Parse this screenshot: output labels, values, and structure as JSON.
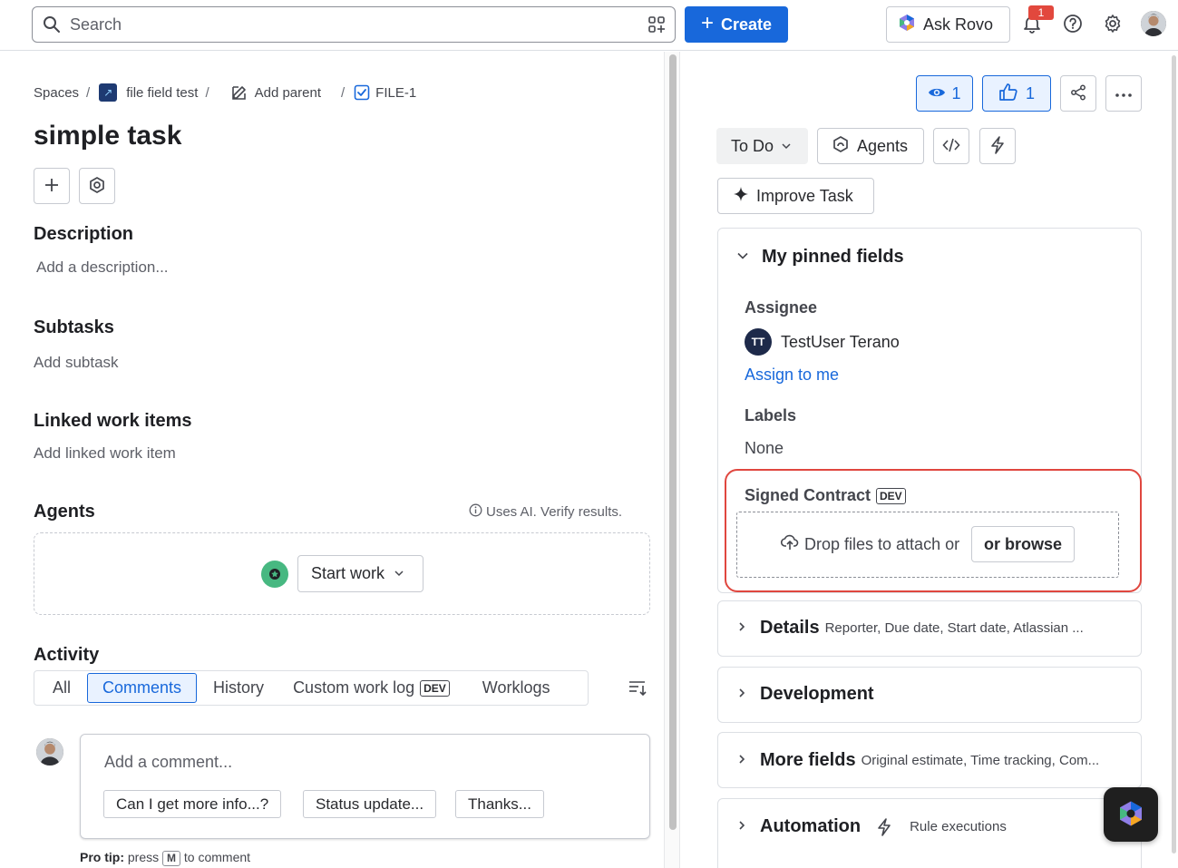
{
  "topbar": {
    "search_placeholder": "Search",
    "create_label": "Create",
    "rovo_label": "Ask Rovo",
    "notification_count": "1",
    "accent": "#1868db"
  },
  "breadcrumb": {
    "spaces": "Spaces",
    "project": "file field test",
    "add_parent": "Add parent",
    "issue_key": "FILE-1"
  },
  "issue": {
    "title": "simple task",
    "description_heading": "Description",
    "description_placeholder": "Add a description...",
    "subtasks_heading": "Subtasks",
    "subtasks_placeholder": "Add subtask",
    "linked_heading": "Linked work items",
    "linked_placeholder": "Add linked work item",
    "agents_heading": "Agents",
    "ai_note": "Uses AI. Verify results.",
    "start_work_label": "Start work"
  },
  "activity": {
    "heading": "Activity",
    "tabs": [
      {
        "label": "All"
      },
      {
        "label": "Comments"
      },
      {
        "label": "History"
      },
      {
        "label": "Custom work log",
        "badge": "DEV"
      },
      {
        "label": "Worklogs"
      }
    ],
    "active_tab": "Comments",
    "comment_placeholder": "Add a comment...",
    "quick_replies": [
      "Can I get more info...?",
      "Status update...",
      "Thanks..."
    ],
    "pro_tip_bold": "Pro tip:",
    "pro_tip_pre": "press",
    "pro_tip_key": "M",
    "pro_tip_post": "to comment"
  },
  "side": {
    "watch_count": "1",
    "like_count": "1",
    "status_label": "To Do",
    "agents_label": "Agents",
    "improve_label": "Improve Task",
    "pinned_heading": "My pinned fields",
    "assignee_label": "Assignee",
    "assignee_initials": "TT",
    "assignee_name": "TestUser Terano",
    "assign_to_me": "Assign to me",
    "labels_label": "Labels",
    "labels_value": "None",
    "signed_label": "Signed Contract",
    "signed_badge": "DEV",
    "drop_text": "Drop files to attach or",
    "browse_label": "or browse",
    "highlight_color": "#e0473f",
    "details_heading": "Details",
    "details_meta": "Reporter, Due date, Start date, Atlassian ...",
    "development_heading": "Development",
    "more_heading": "More fields",
    "more_meta": "Original estimate, Time tracking, Com...",
    "automation_heading": "Automation",
    "automation_meta": "Rule executions"
  }
}
